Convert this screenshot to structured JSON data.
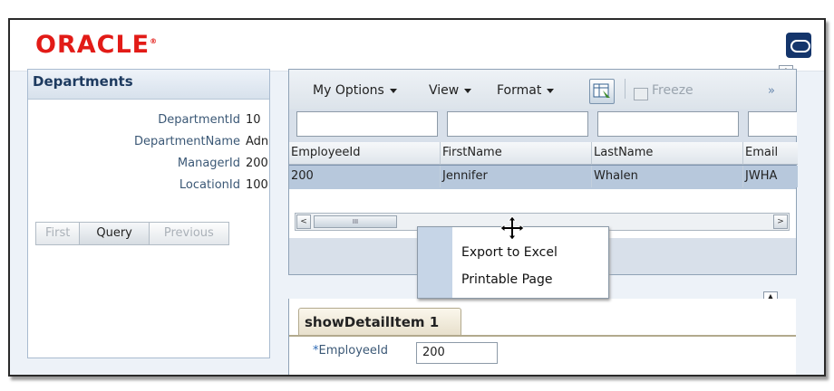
{
  "brand": {
    "logo_text": "ORACLE",
    "logo_mark": "®",
    "app_icon": "app-circle-icon"
  },
  "departments": {
    "title": "Departments",
    "fields": [
      {
        "label": "DepartmentId",
        "value": "10"
      },
      {
        "label": "DepartmentName",
        "value": "Adn"
      },
      {
        "label": "ManagerId",
        "value": "200"
      },
      {
        "label": "LocationId",
        "value": "100"
      }
    ],
    "buttons": {
      "first": "First",
      "query": "Query",
      "previous": "Previous"
    }
  },
  "table": {
    "toolbar": {
      "my_options": "My Options",
      "view": "View",
      "format": "Format",
      "freeze": "Freeze",
      "more": "»"
    },
    "columns": [
      "EmployeeId",
      "FirstName",
      "LastName",
      "Email"
    ],
    "rows": [
      [
        "200",
        "Jennifer",
        "Whalen",
        "JWHA"
      ]
    ],
    "scroll_left": "<",
    "scroll_right": ">",
    "thumb_grip": "III"
  },
  "context_menu": {
    "items": [
      "Export to Excel",
      "Printable Page"
    ]
  },
  "detail": {
    "tab_label": "showDetailItem 1",
    "required_marker": "*",
    "employee_label": "EmployeeId",
    "employee_value": "200"
  },
  "collapse_glyph": "▲",
  "colors": {
    "oracle_red": "#e21b17",
    "row_selected": "#b7c8dc",
    "menu_strip": "#c6d5e7",
    "brand_blue": "#14356b"
  }
}
